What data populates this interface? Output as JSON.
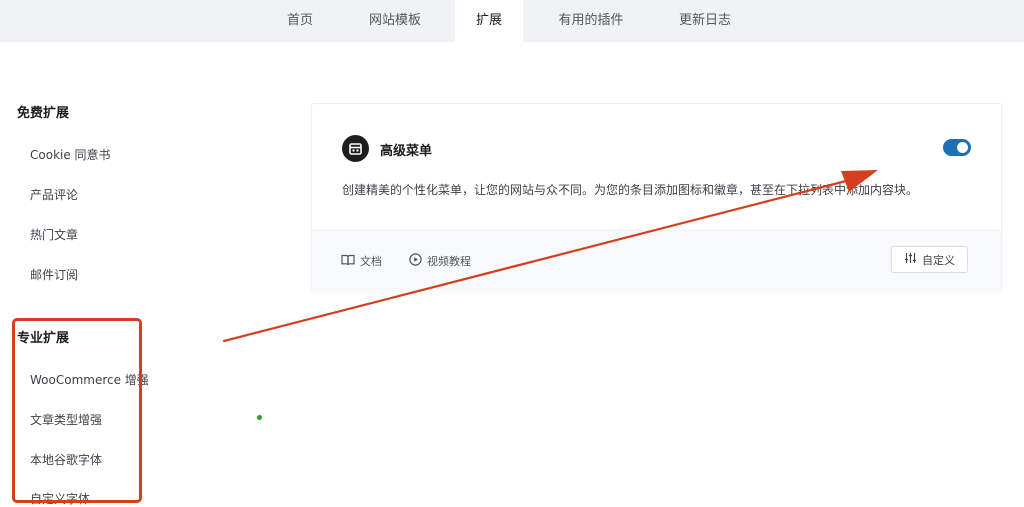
{
  "nav": {
    "tabs": [
      {
        "label": "首页"
      },
      {
        "label": "网站模板"
      },
      {
        "label": "扩展"
      },
      {
        "label": "有用的插件"
      },
      {
        "label": "更新日志"
      }
    ]
  },
  "sidebar": {
    "free_heading": "免费扩展",
    "free_items": [
      {
        "label": "Cookie 同意书"
      },
      {
        "label": "产品评论"
      },
      {
        "label": "热门文章"
      },
      {
        "label": "邮件订阅"
      }
    ],
    "pro_heading": "专业扩展",
    "pro_items": [
      {
        "label": "WooCommerce 增强"
      },
      {
        "label": "文章类型增强"
      },
      {
        "label": "本地谷歌字体"
      },
      {
        "label": "自定义字体"
      }
    ]
  },
  "card": {
    "title": "高级菜单",
    "icon": "menu-calendar-icon",
    "enabled": true,
    "description": "创建精美的个性化菜单，让您的网站与众不同。为您的条目添加图标和徽章，甚至在下拉列表中添加内容块。",
    "docs_label": "文档",
    "video_label": "视频教程",
    "customize_label": "自定义"
  },
  "colors": {
    "accent": "#1f6fb5",
    "annotation": "#d4401f",
    "nav_background": "#f0f2f3"
  }
}
